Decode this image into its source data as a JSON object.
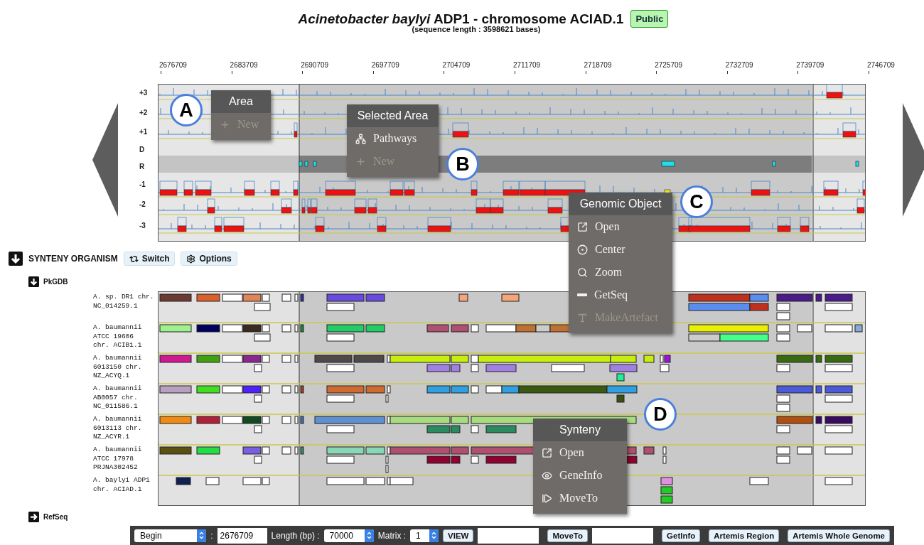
{
  "title": "*Acinetobacter baylyi* ADP1 - chromosome ACIAD.1",
  "badge": "Public",
  "subtitle": "(sequence length : 3598621 bases)",
  "ruler_ticks": [
    "2676709",
    "2683709",
    "2690709",
    "2697709",
    "2704709",
    "2711709",
    "2718709",
    "2725709",
    "2732709",
    "2739709",
    "2746709"
  ],
  "track_labels": [
    "+3",
    "+2",
    "+1",
    "D",
    "R",
    "-1",
    "-2",
    "-3"
  ],
  "synteny": {
    "title": "SYNTENY ORGANISM",
    "expanded": true,
    "buttons": [
      {
        "label": "Switch",
        "kind": "switch"
      },
      {
        "label": "Options",
        "kind": "gear"
      }
    ],
    "source": {
      "name": "PkGDB",
      "expanded": true
    },
    "organisms": [
      {
        "lines": [
          "A. sp. DR1 chr.",
          "NC_014259.1"
        ]
      },
      {
        "lines": [
          "A. baumannii",
          "ATCC 19606",
          "chr. ACIB1.1"
        ]
      },
      {
        "lines": [
          "A. baumannii",
          "6013150 chr.",
          "NZ_ACYQ.1"
        ]
      },
      {
        "lines": [
          "A. baumannii",
          "AB0057 chr.",
          "NC_011586.1"
        ]
      },
      {
        "lines": [
          "A. baumannii",
          "6013113 chr.",
          "NZ_ACYR.1"
        ]
      },
      {
        "lines": [
          "A. baumannii",
          "ATCC 17978",
          "PRJNA302452"
        ]
      },
      {
        "lines": [
          "A. baylyi ADP1",
          "chr. ACIAD.1"
        ]
      }
    ],
    "other_source": {
      "name": "RefSeq",
      "expanded": false
    }
  },
  "menus": [
    {
      "title": "Area",
      "items": [
        {
          "label": "New",
          "kind": "plus",
          "disabled": true
        }
      ]
    },
    {
      "title": "Selected Area",
      "items": [
        {
          "label": "Pathways",
          "kind": "sitemap",
          "disabled": false
        },
        {
          "label": "New",
          "kind": "plus",
          "disabled": true
        }
      ]
    },
    {
      "title": "Genomic Object",
      "items": [
        {
          "label": "Open",
          "kind": "external",
          "disabled": false
        },
        {
          "label": "Center",
          "kind": "target",
          "disabled": false
        },
        {
          "label": "Zoom",
          "kind": "search",
          "disabled": false
        },
        {
          "label": "GetSeq",
          "kind": "minus",
          "disabled": false
        },
        {
          "label": "MakeArtefact",
          "kind": "font",
          "disabled": true
        }
      ]
    },
    {
      "title": "Synteny",
      "items": [
        {
          "label": "Open",
          "kind": "external",
          "disabled": false
        },
        {
          "label": "GeneInfo",
          "kind": "eye",
          "disabled": false
        },
        {
          "label": "MoveTo",
          "kind": "step",
          "disabled": false
        }
      ]
    }
  ],
  "callouts": [
    "A",
    "B",
    "C",
    "D"
  ],
  "toolbar": [
    {
      "kind": "select",
      "value": "Begin"
    },
    {
      "kind": "label",
      "text": ":"
    },
    {
      "kind": "input",
      "value": "2676709"
    },
    {
      "kind": "label",
      "text": "Length (bp) :"
    },
    {
      "kind": "select",
      "value": "70000"
    },
    {
      "kind": "label",
      "text": "Matrix :"
    },
    {
      "kind": "select",
      "value": "1"
    },
    {
      "kind": "button",
      "text": "VIEW"
    },
    {
      "kind": "input"
    },
    {
      "kind": "button",
      "text": "MoveTo"
    },
    {
      "kind": "input"
    },
    {
      "kind": "button",
      "text": "GetInfo"
    },
    {
      "kind": "button",
      "text": "Artemis Region"
    },
    {
      "kind": "button",
      "text": "Artemis Whole Genome"
    }
  ]
}
